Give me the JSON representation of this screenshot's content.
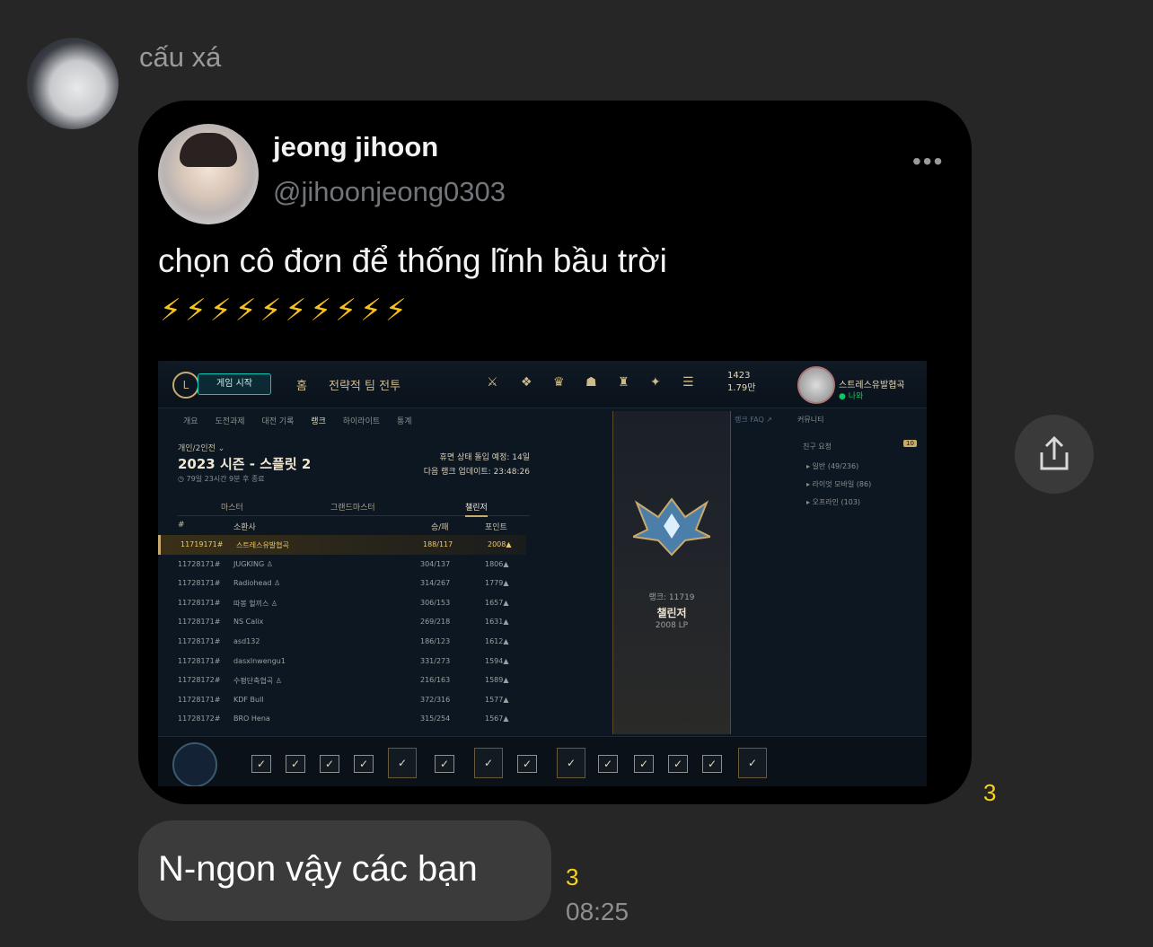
{
  "chat": {
    "sender_name": "cấu xá",
    "message_text": "N-ngon vậy các bạn",
    "message_time": "08:25",
    "reaction_count_tweet": "3",
    "reaction_count_message": "3"
  },
  "tweet": {
    "name": "jeong jihoon",
    "handle": "@jihoonjeong0303",
    "text": "chọn cô đơn để thống lĩnh bầu trời",
    "emoji": "⚡⚡⚡⚡⚡⚡⚡⚡⚡⚡",
    "more_label": "•••"
  },
  "screenshot": {
    "play_label": "게임 시작",
    "home_label": "홈",
    "tft_label": "전략적 팀 전투",
    "currency_be": "1423",
    "currency_rp": "1.79만",
    "summoner_name": "스트레스유발협곡",
    "summoner_status": "● 나와",
    "subnav": [
      "개요",
      "도전과제",
      "대전 기록",
      "랭크",
      "하이라이트",
      "통계"
    ],
    "queue_label": "개인/2인전 ⌄",
    "season_title": "2023 시즌 - 스플릿 2",
    "season_subtext": "◷ 79일 23시간 9분 후 종료",
    "info_line1": "휴면 상태 돌입 예정: 14일",
    "info_line2": "다음 랭크 업데이트: 23:48:26",
    "tabs": [
      "마스터",
      "그랜드마스터",
      "챌린저"
    ],
    "headers": [
      "#",
      "소환사",
      "승/패",
      "포인트"
    ],
    "rows": [
      {
        "rank": "11719171#",
        "name": "스트레스유발협곡",
        "wl": "188/117",
        "lp": "2008▲"
      },
      {
        "rank": "11728171#",
        "name": "JUGKING ♙",
        "wl": "304/137",
        "lp": "1806▲"
      },
      {
        "rank": "11728171#",
        "name": "Radiohead ♙",
        "wl": "314/267",
        "lp": "1779▲"
      },
      {
        "rank": "11728171#",
        "name": "따봉 헐끼스 ♙",
        "wl": "306/153",
        "lp": "1657▲"
      },
      {
        "rank": "11728171#",
        "name": "NS Calix",
        "wl": "269/218",
        "lp": "1631▲"
      },
      {
        "rank": "11728171#",
        "name": "asd132",
        "wl": "186/123",
        "lp": "1612▲"
      },
      {
        "rank": "11728171#",
        "name": "dasxlnwengu1",
        "wl": "331/273",
        "lp": "1594▲"
      },
      {
        "rank": "11728172#",
        "name": "수평단축협곡 ♙",
        "wl": "216/163",
        "lp": "1589▲"
      },
      {
        "rank": "11728171#",
        "name": "KDF Bull",
        "wl": "372/316",
        "lp": "1577▲"
      },
      {
        "rank": "11728172#",
        "name": "BRO Hena",
        "wl": "315/254",
        "lp": "1567▲"
      }
    ],
    "rank_number": "랭크: 11719",
    "rank_name": "챌린저",
    "rank_lp": "2008 LP",
    "faq_label": "랭크 FAQ ↗",
    "social_title": "커뮤니티",
    "friend_requests": "친구 요청",
    "friend_badge": "10",
    "groups": [
      "▸ 일반 (49/236)",
      "▸ 라이엇 모바일 (86)",
      "▸ 오프라인 (103)"
    ],
    "checkmark": "✓"
  },
  "colors": {
    "background": "#262626",
    "card": "#000000",
    "bubble": "#3b3b3b",
    "reaction": "#f7d21a",
    "lol_gold": "#c8aa6e"
  },
  "icons": {
    "share": "share-icon",
    "more": "more-dots-icon"
  }
}
